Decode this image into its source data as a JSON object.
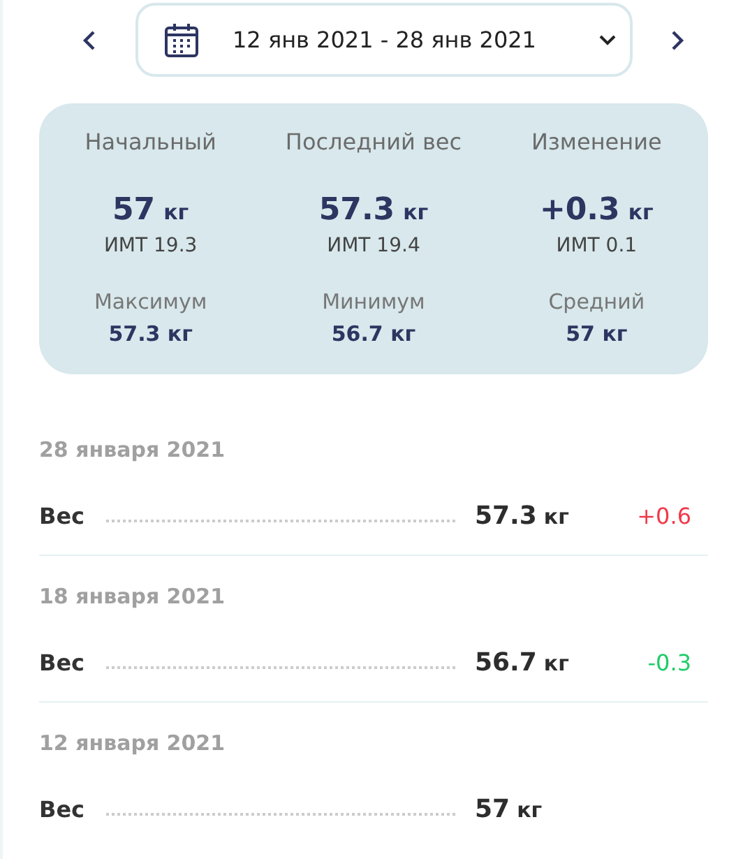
{
  "date_range": {
    "label": "12 янв 2021 - 28 янв 2021"
  },
  "stats": [
    {
      "label": "Начальный",
      "value": "57",
      "unit": "кг",
      "bmi": "ИМТ 19.3",
      "sub_label": "Максимум",
      "sub_value": "57.3 кг"
    },
    {
      "label": "Последний вес",
      "value": "57.3",
      "unit": "кг",
      "bmi": "ИМТ 19.4",
      "sub_label": "Минимум",
      "sub_value": "56.7 кг"
    },
    {
      "label": "Изменение",
      "value": "+0.3",
      "unit": "кг",
      "bmi": "ИМТ 0.1",
      "sub_label": "Средний",
      "sub_value": "57 кг"
    }
  ],
  "entries": [
    {
      "date": "28 января 2021",
      "label": "Вес",
      "value": "57.3",
      "unit": "кг",
      "change": "+0.6",
      "color": "#f03a4a"
    },
    {
      "date": "18 января 2021",
      "label": "Вес",
      "value": "56.7",
      "unit": "кг",
      "change": "-0.3",
      "color": "#1fcc6a"
    },
    {
      "date": "12 января 2021",
      "label": "Вес",
      "value": "57",
      "unit": "кг"
    }
  ]
}
